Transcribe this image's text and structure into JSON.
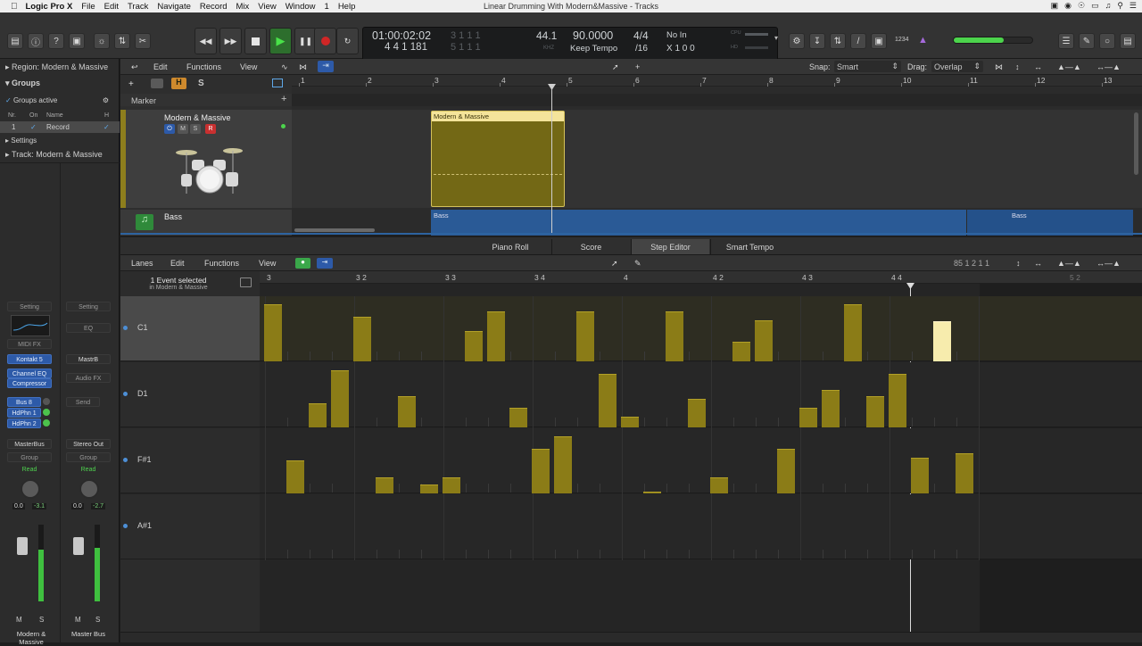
{
  "menubar": {
    "apple": "",
    "app": "Logic Pro X",
    "items": [
      "File",
      "Edit",
      "Track",
      "Navigate",
      "Record",
      "Mix",
      "View",
      "Window",
      "1",
      "Help"
    ],
    "title": "Linear Drumming With Modern&Massive - Tracks"
  },
  "lcd": {
    "time": "01:00:02:02",
    "bars": "4  4  1  181",
    "ghost1": "3  1  1    1",
    "ghost2": "5  1  1    1",
    "rate": "44.1",
    "rate_unit": "KHZ",
    "tempo": "90.0000",
    "tempo_mode": "Keep Tempo",
    "sig": "4/4",
    "div": "/16",
    "in": "No In",
    "out": "X  1  0  0",
    "cpu": "CPU",
    "hd": "HD"
  },
  "toolbar": {
    "count_in": "1234"
  },
  "inspector": {
    "region": "Region:",
    "region_name": "Modern & Massive",
    "groups": "Groups",
    "groups_active": "Groups active",
    "cols": [
      "Nr.",
      "On",
      "Name",
      "H"
    ],
    "group_nr": "1",
    "group_name": "Record",
    "settings": "Settings",
    "track": "Track:",
    "track_name": "Modern & Massive"
  },
  "strip1": {
    "setting": "Setting",
    "midifx": "MIDI FX",
    "inst": "Kontakt 5",
    "fx1": "Channel EQ",
    "fx2": "Compressor",
    "send1": "Bus 8",
    "send2": "HdPhn 1",
    "send3": "HdPhn 2",
    "out": "MasterBus",
    "group": "Group",
    "auto": "Read",
    "vol": "0.0",
    "pk": "-3.1",
    "m": "M",
    "s": "S",
    "name": "Modern & Massive"
  },
  "strip2": {
    "setting": "Setting",
    "eq": "EQ",
    "link": "MastrB",
    "audiofx": "Audio FX",
    "send": "Send",
    "out": "Stereo Out",
    "group": "Group",
    "auto": "Read",
    "vol": "0.0",
    "pk": "-2.7",
    "m": "M",
    "s": "S",
    "name": "Master Bus"
  },
  "tracks": {
    "edit": "Edit",
    "functions": "Functions",
    "view": "View",
    "snap_label": "Snap:",
    "snap": "Smart",
    "drag_label": "Drag:",
    "drag": "Overlap",
    "marker": "Marker",
    "ruler": [
      "1",
      "2",
      "3",
      "4",
      "5",
      "6",
      "7",
      "8",
      "9",
      "10",
      "11",
      "12",
      "13"
    ],
    "track1": "Modern & Massive",
    "t1_m": "M",
    "t1_s": "S",
    "t1_r": "R",
    "track2": "Bass",
    "region1": "Modern & Massive",
    "bass1": "Bass",
    "bass2": "Bass",
    "H": "H",
    "S": "S"
  },
  "tabs": [
    "Piano Roll",
    "Score",
    "Step Editor",
    "Smart Tempo"
  ],
  "step": {
    "lanes": "Lanes",
    "edit": "Edit",
    "functions": "Functions",
    "view": "View",
    "selected": "1 Event selected",
    "selected_sub": "in Modern & Massive",
    "pos": "85   1 2 1 1",
    "ruler": [
      "3",
      "3 2",
      "3 3",
      "3 4",
      "4",
      "4 2",
      "4 3",
      "4 4",
      "5 2"
    ],
    "lanes_list": [
      "C1",
      "D1",
      "F#1",
      "A#1"
    ]
  },
  "accent": "#8b7c17",
  "selected_color": "#f7ecad",
  "step_events": [
    {
      "lane": 0,
      "step": 0,
      "vel": 100
    },
    {
      "lane": 0,
      "step": 4,
      "vel": 78
    },
    {
      "lane": 0,
      "step": 9,
      "vel": 53
    },
    {
      "lane": 0,
      "step": 10,
      "vel": 88
    },
    {
      "lane": 0,
      "step": 14,
      "vel": 88
    },
    {
      "lane": 0,
      "step": 18,
      "vel": 88
    },
    {
      "lane": 0,
      "step": 21,
      "vel": 35
    },
    {
      "lane": 0,
      "step": 22,
      "vel": 72
    },
    {
      "lane": 0,
      "step": 26,
      "vel": 100
    },
    {
      "lane": 0,
      "step": 30,
      "vel": 70,
      "selected": true
    },
    {
      "lane": 1,
      "step": 2,
      "vel": 42
    },
    {
      "lane": 1,
      "step": 3,
      "vel": 100
    },
    {
      "lane": 1,
      "step": 6,
      "vel": 55
    },
    {
      "lane": 1,
      "step": 11,
      "vel": 35
    },
    {
      "lane": 1,
      "step": 15,
      "vel": 93
    },
    {
      "lane": 1,
      "step": 16,
      "vel": 18
    },
    {
      "lane": 1,
      "step": 19,
      "vel": 50
    },
    {
      "lane": 1,
      "step": 24,
      "vel": 35
    },
    {
      "lane": 1,
      "step": 25,
      "vel": 65
    },
    {
      "lane": 1,
      "step": 27,
      "vel": 55
    },
    {
      "lane": 1,
      "step": 28,
      "vel": 93
    },
    {
      "lane": 2,
      "step": 1,
      "vel": 58
    },
    {
      "lane": 2,
      "step": 5,
      "vel": 28
    },
    {
      "lane": 2,
      "step": 7,
      "vel": 16
    },
    {
      "lane": 2,
      "step": 8,
      "vel": 28
    },
    {
      "lane": 2,
      "step": 12,
      "vel": 78
    },
    {
      "lane": 2,
      "step": 13,
      "vel": 100
    },
    {
      "lane": 2,
      "step": 17,
      "vel": 3
    },
    {
      "lane": 2,
      "step": 20,
      "vel": 28
    },
    {
      "lane": 2,
      "step": 23,
      "vel": 78
    },
    {
      "lane": 2,
      "step": 29,
      "vel": 62
    },
    {
      "lane": 2,
      "step": 31,
      "vel": 70
    }
  ]
}
